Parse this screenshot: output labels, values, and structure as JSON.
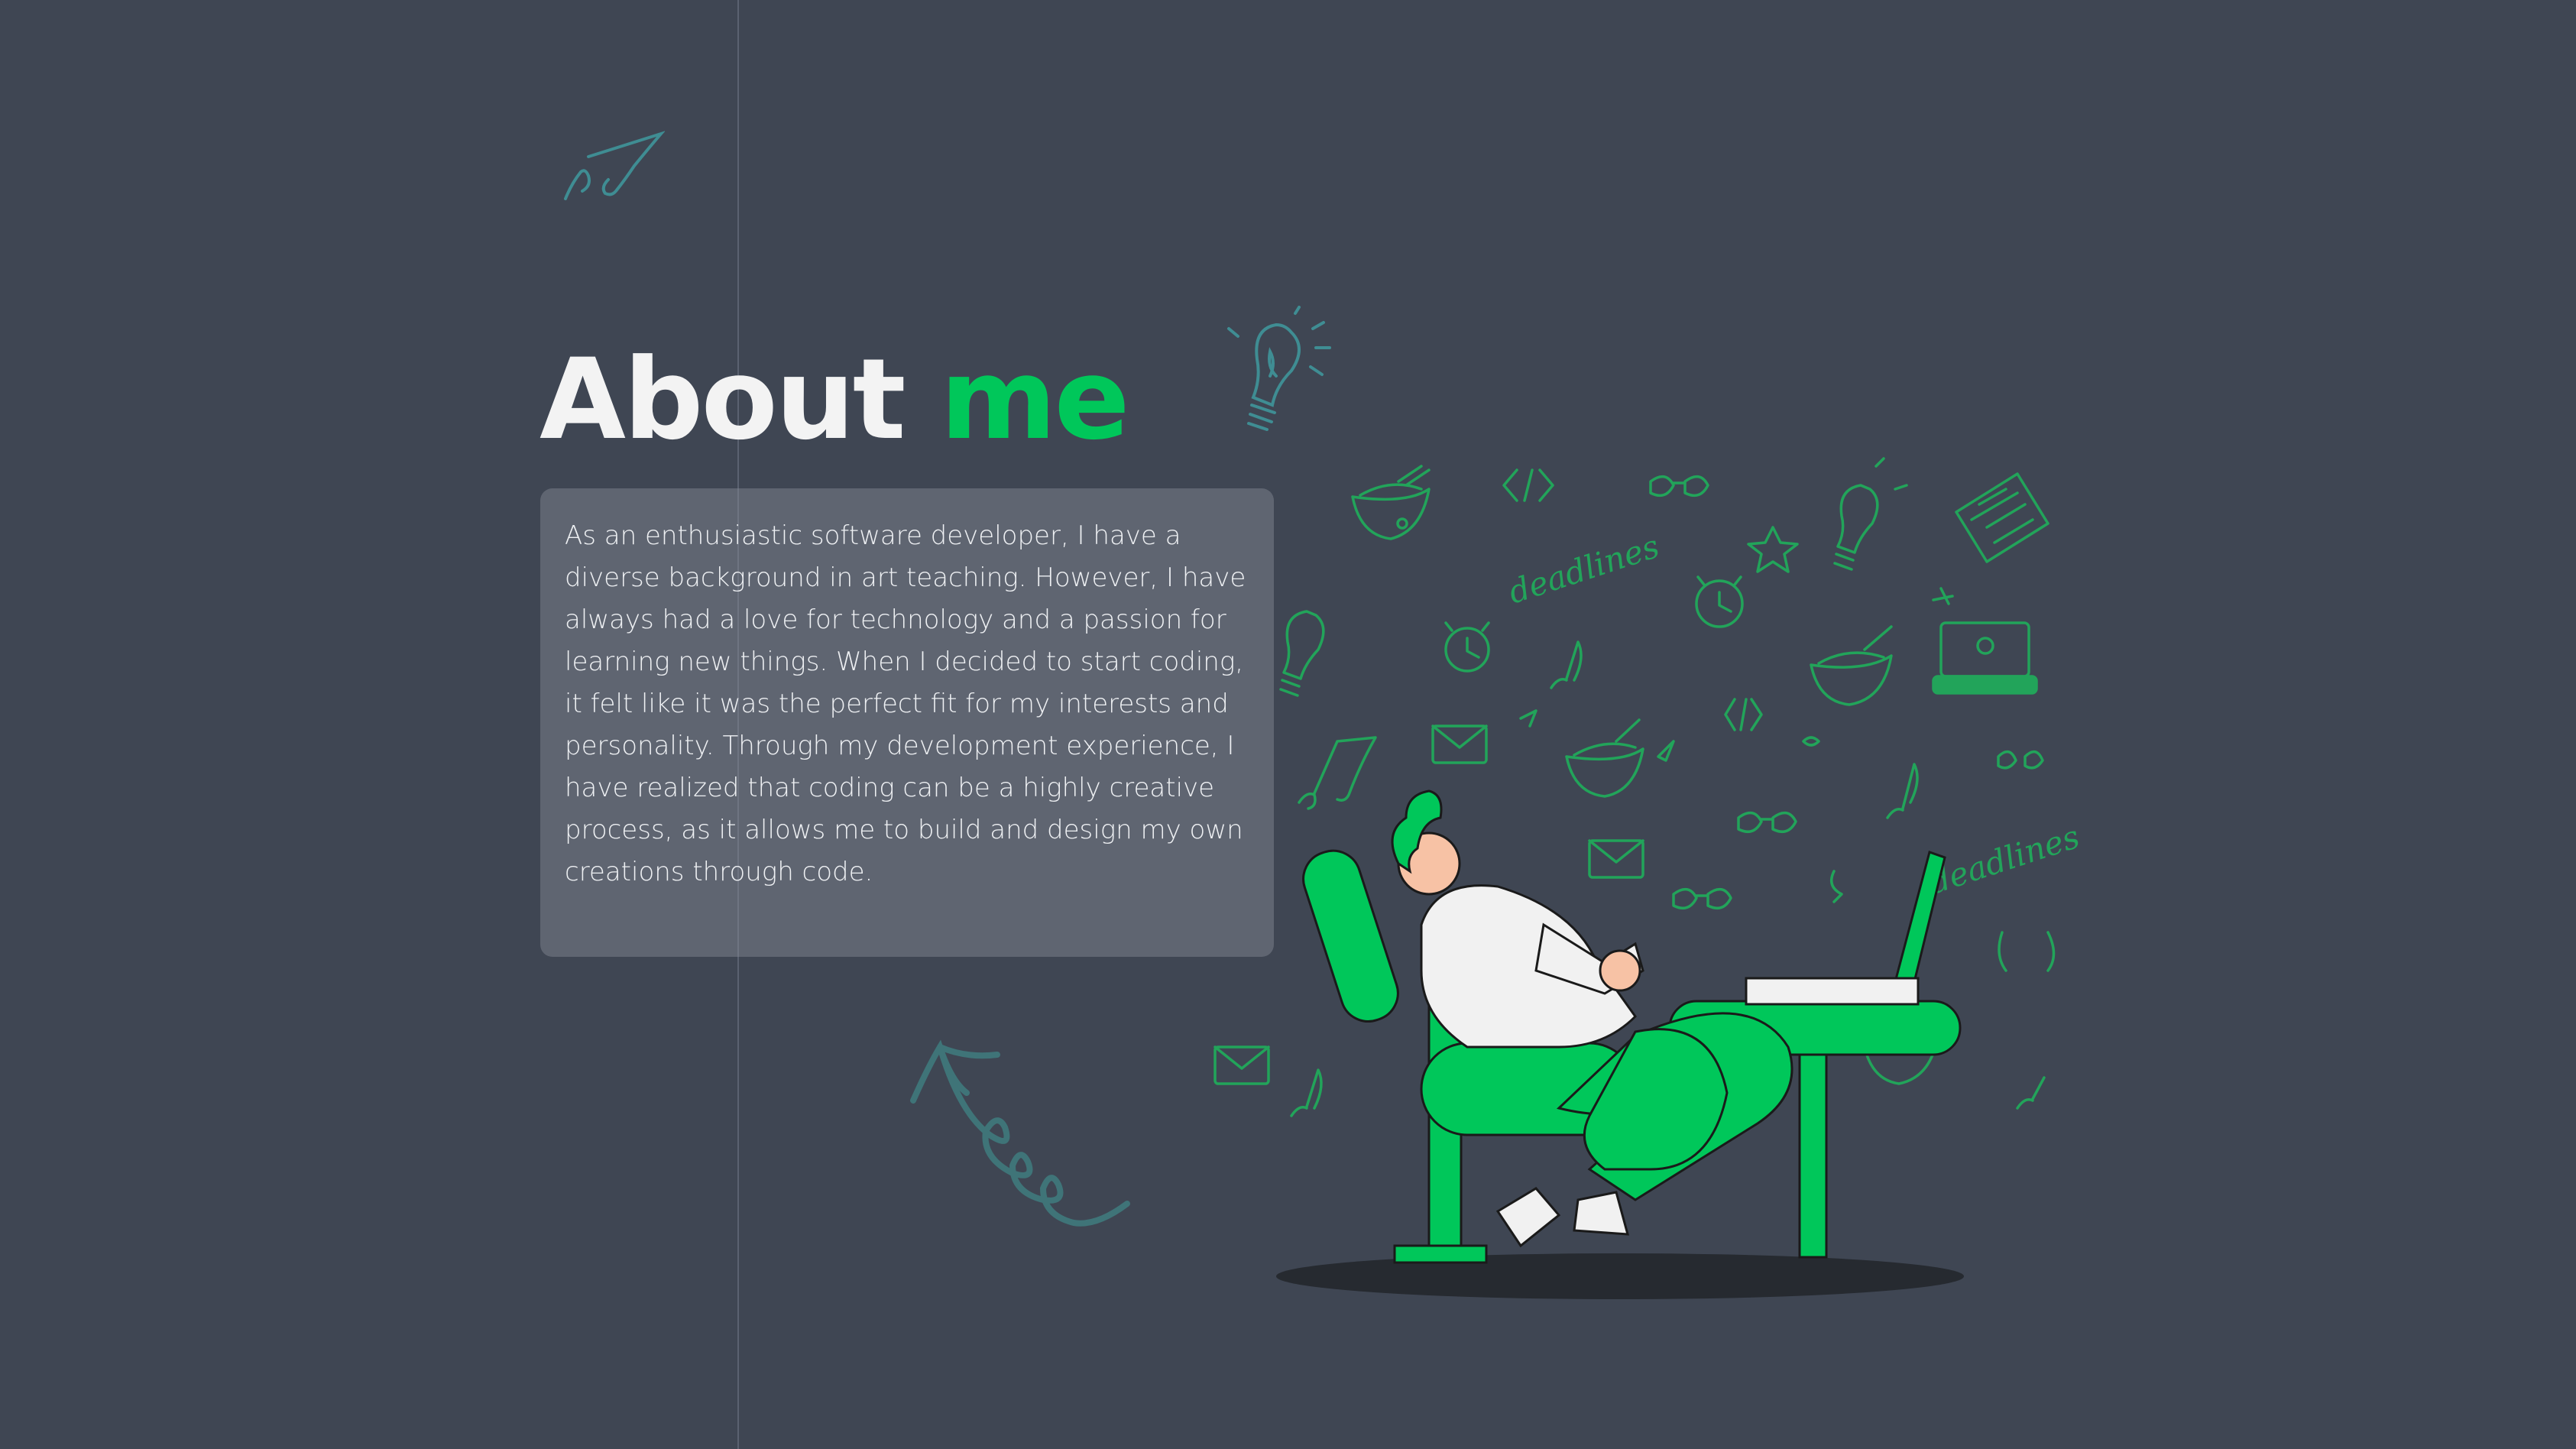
{
  "about": {
    "title_main": "About",
    "title_accent": "me",
    "bio": "As an enthusiastic software developer, I have a diverse background in art teaching. However, I have always had a love for technology and a passion for learning new things. When I decided to start coding, it felt like it was the perfect fit for my interests and personality. Through my development experience, I have realized that coding can be a highly creative process, as it allows me to build and design my own creations through code."
  },
  "colors": {
    "background": "#3f4653",
    "accent": "#00c75a",
    "card": "#787d88",
    "text": "#eef0f3",
    "doodle_teal": "#3f8d93"
  },
  "icons": [
    "music-note-icon",
    "lightbulb-icon",
    "spiral-arrow-icon"
  ],
  "illustration": {
    "doodle_text": "deadlines"
  }
}
